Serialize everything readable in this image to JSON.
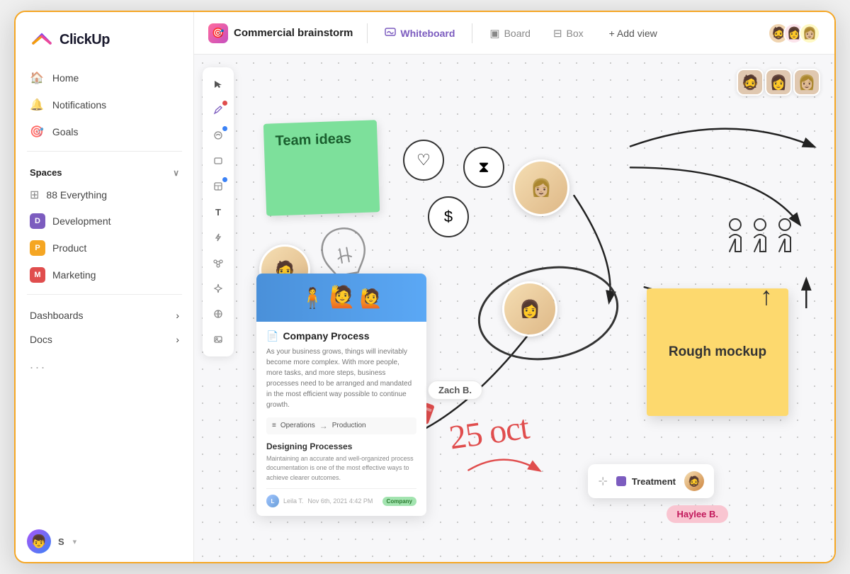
{
  "app": {
    "name": "ClickUp"
  },
  "sidebar": {
    "logo_text": "ClickUp",
    "nav_items": [
      {
        "id": "home",
        "label": "Home",
        "icon": "🏠"
      },
      {
        "id": "notifications",
        "label": "Notifications",
        "icon": "🔔"
      },
      {
        "id": "goals",
        "label": "Goals",
        "icon": "🎯"
      }
    ],
    "spaces_label": "Spaces",
    "spaces": [
      {
        "id": "everything",
        "label": "88 Everything",
        "type": "all"
      },
      {
        "id": "development",
        "label": "Development",
        "type": "space",
        "color": "#7c5cbf",
        "letter": "D"
      },
      {
        "id": "product",
        "label": "Product",
        "type": "space",
        "color": "#f5a623",
        "letter": "P"
      },
      {
        "id": "marketing",
        "label": "Marketing",
        "type": "space",
        "color": "#e04d4d",
        "letter": "M"
      }
    ],
    "bottom_items": [
      {
        "id": "dashboards",
        "label": "Dashboards"
      },
      {
        "id": "docs",
        "label": "Docs"
      }
    ],
    "more_label": "...",
    "user_initial": "S"
  },
  "topbar": {
    "project_name": "Commercial brainstorm",
    "tabs": [
      {
        "id": "whiteboard",
        "label": "Whiteboard",
        "icon": "⊞",
        "active": true
      },
      {
        "id": "board",
        "label": "Board",
        "icon": "▣",
        "active": false
      },
      {
        "id": "box",
        "label": "Box",
        "icon": "⊟",
        "active": false
      }
    ],
    "add_view_label": "+ Add view",
    "avatars": [
      "🧔",
      "👩",
      "👩🏼"
    ]
  },
  "canvas": {
    "sticky_green": {
      "text": "Team ideas"
    },
    "sticky_yellow": {
      "text": "Rough mockup"
    },
    "doc_card": {
      "header_label": "Company Process",
      "body_text": "As your business grows, things will inevitably become more complex. With more people, more tasks, and more steps, business processes need to be arranged and mandated in the most efficient way possible to continue growth.",
      "flow_from": "Operations",
      "flow_to": "Production",
      "section": "Designing Processes",
      "section_desc": "Maintaining an accurate and well-organized process documentation is one of the most effective ways to achieve clearer outcomes.",
      "footer_author": "Leila T.",
      "footer_date": "Nov 6th, 2021 4:42 PM",
      "footer_badge": "Company"
    },
    "zach_label": "Zach B.",
    "oct_text": "25 oct",
    "treatment_label": "Treatment",
    "haylee_label": "Haylee B.",
    "people_icons_count": 3
  }
}
